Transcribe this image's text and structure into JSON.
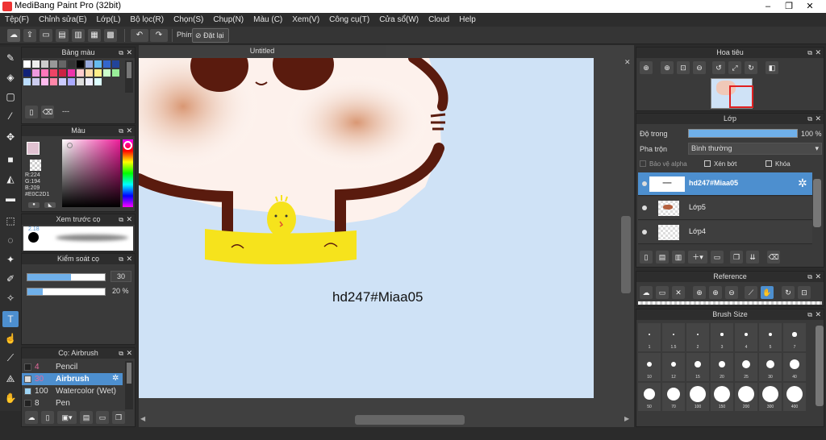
{
  "window": {
    "title": "MediBang Paint Pro (32bit)"
  },
  "menu": [
    "Tệp(F)",
    "Chỉnh sửa(E)",
    "Lớp(L)",
    "Bộ lọc(R)",
    "Chọn(S)",
    "Chụp(N)",
    "Màu (C)",
    "Xem(V)",
    "Công cụ(T)",
    "Cửa sổ(W)",
    "Cloud",
    "Help"
  ],
  "toolbar": {
    "shortcut_label": "Phím",
    "reset_label": "Đặt lại"
  },
  "palette": {
    "title": "Bảng màu",
    "dash": "---"
  },
  "color": {
    "title": "Màu",
    "r": "R:224",
    "g": "G:194",
    "b": "B:209",
    "hex": "#E0C2D1"
  },
  "brush_preview": {
    "title": "Xem trước cọ",
    "size": "2.18"
  },
  "brush_control": {
    "title": "Kiểm soát cọ",
    "size_value": "30",
    "opacity_value": "20 %"
  },
  "brush_list": {
    "title": "Cọ: Airbrush",
    "items": [
      {
        "size": "4",
        "name": "Pencil"
      },
      {
        "size": "30",
        "name": "Airbrush"
      },
      {
        "size": "100",
        "name": "Watercolor (Wet)"
      },
      {
        "size": "8",
        "name": "Pen"
      }
    ]
  },
  "document": {
    "tab": "Untitled",
    "canvas_text": "hd247#Miaa05"
  },
  "navigator": {
    "title": "Hoa tiêu"
  },
  "layers": {
    "title": "Lớp",
    "opacity_label": "Độ trong",
    "opacity_value": "100 %",
    "blend_label": "Pha trộn",
    "blend_value": "Bình thường",
    "protect_alpha": "Bảo vệ alpha",
    "clipping": "Xén bớt",
    "lock": "Khóa",
    "items": [
      "hd247#Miaa05",
      "Lớp5",
      "Lớp4"
    ]
  },
  "reference": {
    "title": "Reference"
  },
  "brush_size": {
    "title": "Brush Size",
    "sizes": [
      "1",
      "1.5",
      "2",
      "3",
      "4",
      "5",
      "7",
      "10",
      "12",
      "15",
      "20",
      "25",
      "30",
      "40",
      "50",
      "70",
      "100",
      "150",
      "200",
      "300",
      "400"
    ]
  },
  "colors": {
    "accent": "#4d8fcf",
    "canvas_bg": "#cfe2f6"
  }
}
